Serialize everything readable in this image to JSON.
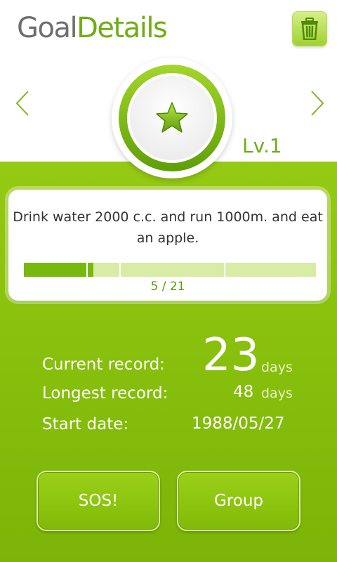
{
  "header": {
    "title_part1": "Goal",
    "title_part2": "Details",
    "delete_icon": "trash-icon"
  },
  "goal": {
    "icon": "star-icon",
    "level": "Lv.1",
    "description": "Drink water 2000 c.c. and run 1000m. and eat an apple.",
    "progress_text": "5 / 21",
    "progress_value": 5,
    "progress_total": 21
  },
  "stats": {
    "current_label": "Current record:",
    "current_value": "23",
    "current_unit": "days",
    "longest_label": "Longest record:",
    "longest_value": "48",
    "longest_unit": "days",
    "start_label": "Start date:",
    "start_value": "1988/05/27"
  },
  "buttons": {
    "sos": "SOS!",
    "group": "Group"
  },
  "colors": {
    "accent": "#6fae14",
    "background_green": "#8cc40f",
    "progress_fill": "#79b80e",
    "progress_track": "#d8eca6"
  }
}
